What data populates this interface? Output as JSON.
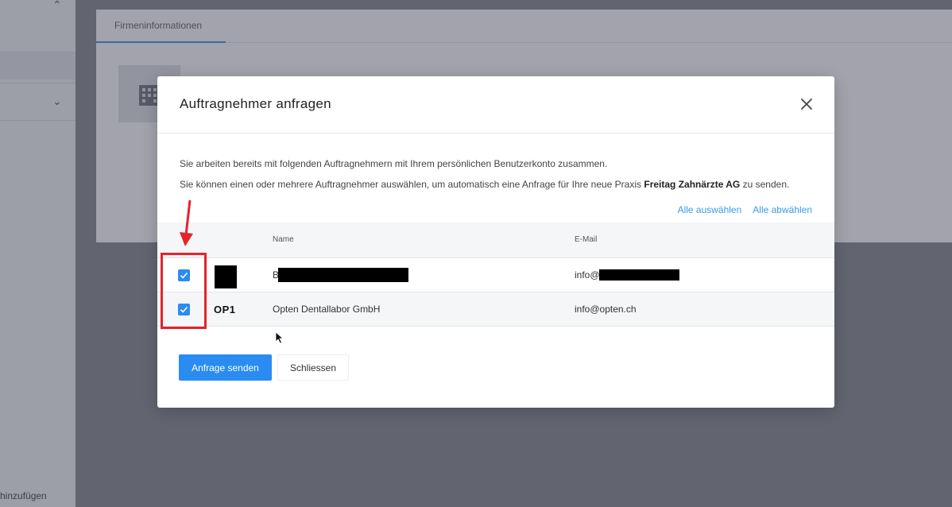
{
  "background": {
    "tab_label": "Firmeninformationen",
    "sidebar_add_label": "hinzufügen"
  },
  "modal": {
    "title": "Auftragnehmer anfragen",
    "description_line1": "Sie arbeiten bereits mit folgenden Auftragnehmern mit Ihrem persönlichen Benutzerkonto zusammen.",
    "description_line2_prefix": "Sie können einen oder mehrere Auftragnehmer auswählen, um automatisch eine Anfrage für Ihre neue Praxis ",
    "description_line2_bold": "Freitag Zahnärzte AG",
    "description_line2_suffix": " zu senden.",
    "select_all_label": "Alle auswählen",
    "deselect_all_label": "Alle abwählen",
    "columns": {
      "name": "Name",
      "email": "E-Mail"
    },
    "rows": [
      {
        "checked": true,
        "logo_text": "",
        "name": "B",
        "email": "info@"
      },
      {
        "checked": true,
        "logo_text": "OP1",
        "name": "Opten Dentallabor GmbH",
        "email": "info@opten.ch"
      }
    ],
    "send_button_label": "Anfrage senden",
    "close_button_label": "Schliessen"
  },
  "colors": {
    "accent": "#2a8cf0",
    "link": "#3a9be8",
    "annotation": "#e3242b"
  }
}
